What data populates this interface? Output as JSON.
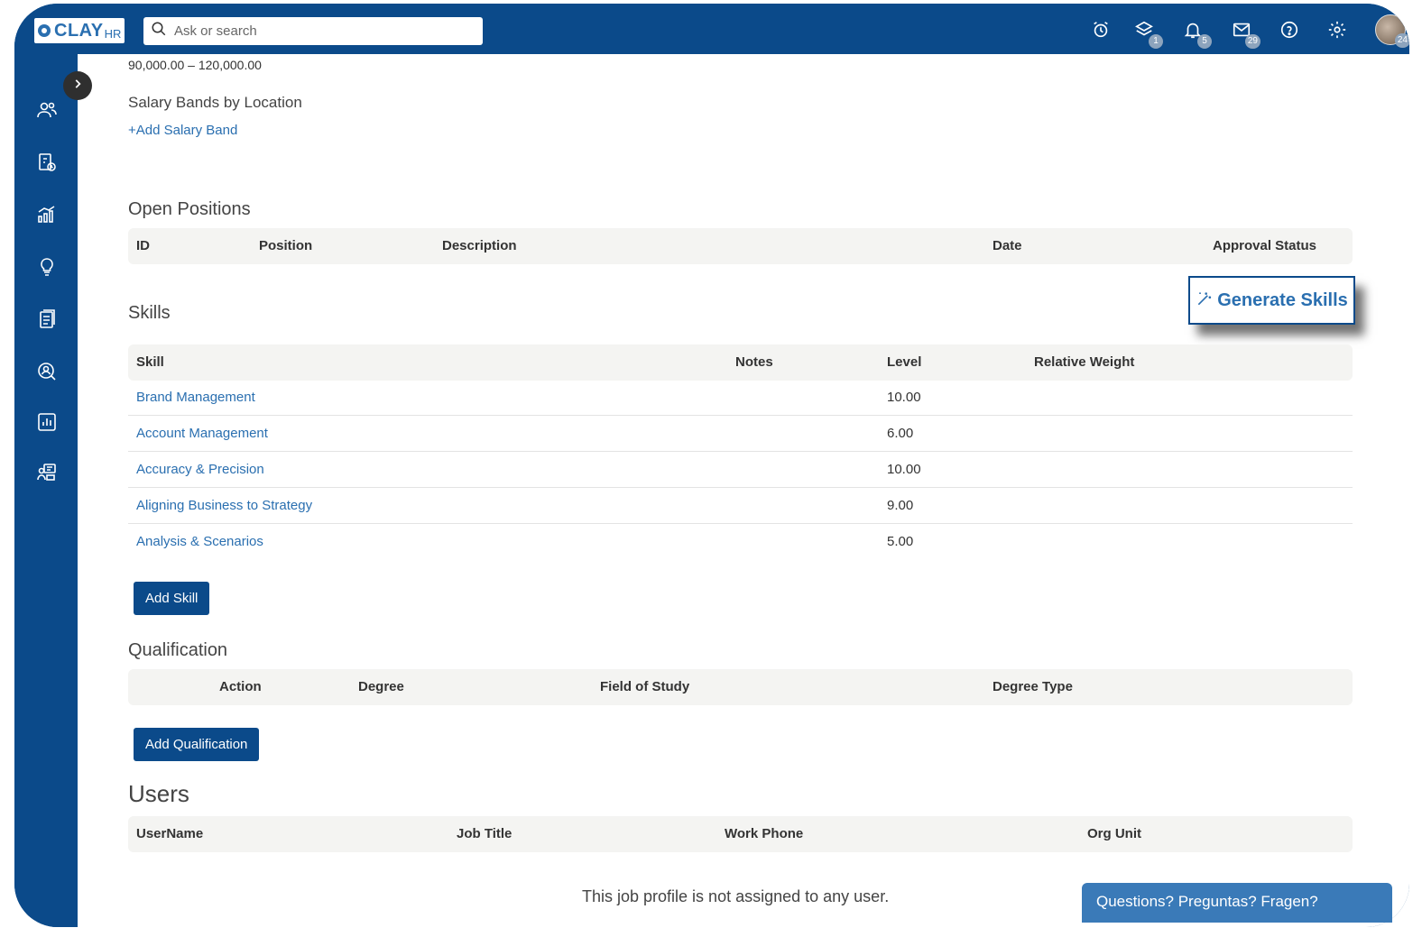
{
  "app": {
    "logo_text": "CLAY",
    "logo_suffix": "HR"
  },
  "search": {
    "placeholder": "Ask or search"
  },
  "topbar": {
    "icons": [
      {
        "name": "alarm-icon"
      },
      {
        "name": "layers-icon",
        "badge": "1"
      },
      {
        "name": "bell-icon",
        "badge": "5"
      },
      {
        "name": "mail-icon",
        "badge": "29"
      },
      {
        "name": "help-icon"
      },
      {
        "name": "gear-icon"
      }
    ],
    "avatar_badge": "24"
  },
  "sidebar": {
    "items": [
      {
        "name": "people-icon"
      },
      {
        "name": "payroll-icon"
      },
      {
        "name": "analytics-icon"
      },
      {
        "name": "ideas-icon"
      },
      {
        "name": "documents-icon"
      },
      {
        "name": "recruiting-icon"
      },
      {
        "name": "reports-icon"
      },
      {
        "name": "org-chart-icon"
      }
    ]
  },
  "salary": {
    "range": "90,000.00 – 120,000.00",
    "bands_title": "Salary Bands by Location",
    "add_band": "+Add Salary Band"
  },
  "open_positions": {
    "title": "Open Positions",
    "columns": [
      "ID",
      "Position",
      "Description",
      "Date",
      "Approval Status"
    ]
  },
  "skills": {
    "title": "Skills",
    "generate_label": "Generate Skills",
    "columns": [
      "Skill",
      "Notes",
      "Level",
      "Relative Weight"
    ],
    "rows": [
      {
        "skill": "Brand Management",
        "notes": "",
        "level": "10.00",
        "weight": ""
      },
      {
        "skill": "Account Management",
        "notes": "",
        "level": "6.00",
        "weight": ""
      },
      {
        "skill": "Accuracy & Precision",
        "notes": "",
        "level": "10.00",
        "weight": ""
      },
      {
        "skill": "Aligning Business to Strategy",
        "notes": "",
        "level": "9.00",
        "weight": ""
      },
      {
        "skill": "Analysis & Scenarios",
        "notes": "",
        "level": "5.00",
        "weight": ""
      }
    ],
    "add_label": "Add Skill"
  },
  "qualification": {
    "title": "Qualification",
    "columns": [
      "Action",
      "Degree",
      "Field of Study",
      "Degree Type"
    ],
    "add_label": "Add Qualification"
  },
  "users": {
    "title": "Users",
    "columns": [
      "UserName",
      "Job Title",
      "Work Phone",
      "Org Unit"
    ],
    "empty_message": "This job profile is not assigned to any user."
  },
  "chat": {
    "label": "Questions? Preguntas? Fragen?"
  },
  "colors": {
    "brand": "#0b4a8a",
    "link": "#2a6fb0",
    "header_bg": "#f4f4f2"
  }
}
